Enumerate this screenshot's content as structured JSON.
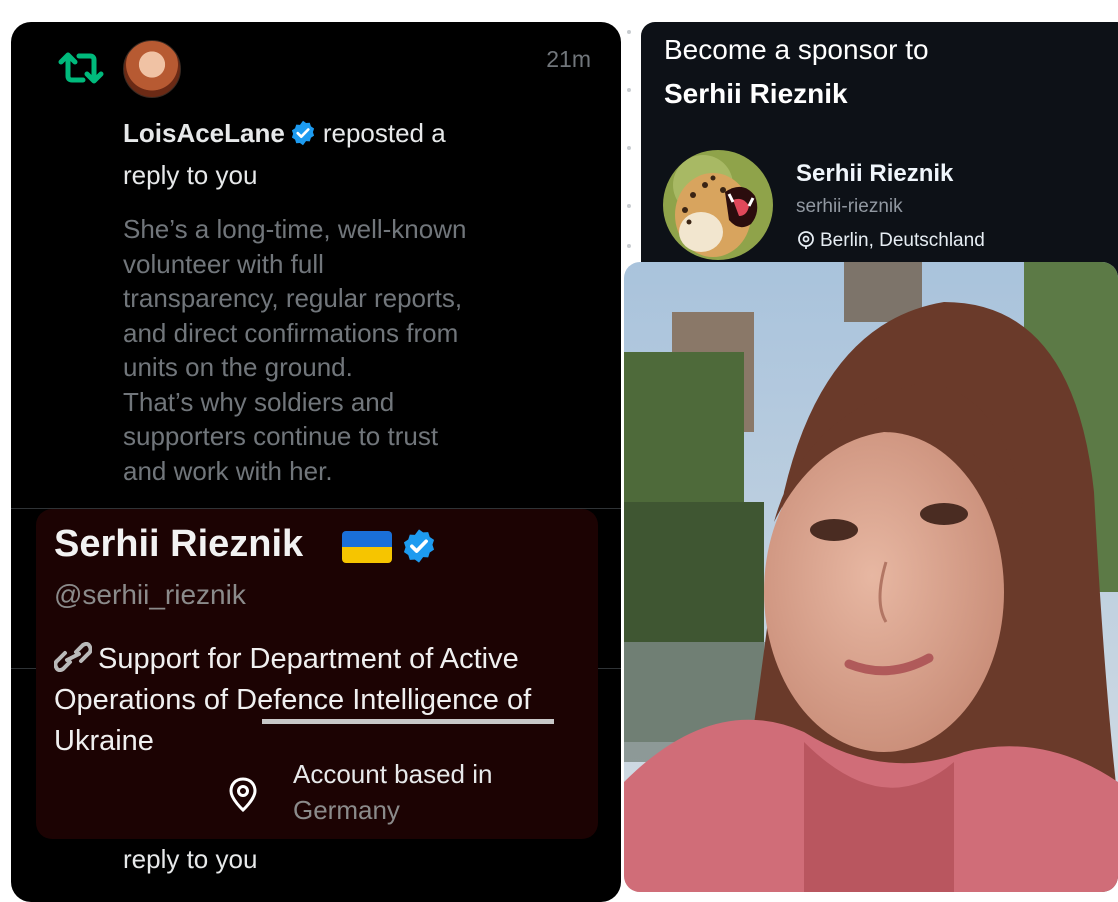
{
  "notification": {
    "time": "21m",
    "user": "LoisAceLane",
    "action": "reposted a",
    "line2": "reply to you",
    "reply_lines": [
      "She’s a long-time, well-known",
      "volunteer with full",
      "transparency, regular reports,",
      "and direct confirmations from",
      "units on the ground.",
      "That’s why soldiers and",
      "supporters continue to trust",
      "and work with her."
    ],
    "bottom_line": "reply to you",
    "colors": {
      "retweet": "#00ba7c",
      "verified": "#1d9bf0",
      "background": "#000000"
    }
  },
  "profile": {
    "name": "Serhii Rieznik",
    "handle": "@serhii_rieznik",
    "bio_line1": "Support for Department of Active",
    "bio_line2": "Operations of Defence Intelligence of",
    "bio_line3": "Ukraine",
    "based_label": "Account based in",
    "based_value": "Germany",
    "flag_colors": [
      "#1a6fd8",
      "#f6c500"
    ]
  },
  "sponsor": {
    "title1": "Become a sponsor to",
    "title2": "Serhii Rieznik",
    "name": "Serhii Rieznik",
    "login": "serhii-rieznik",
    "location": "Berlin, Deutschland"
  },
  "icons": [
    "retweet-icon",
    "verified-icon",
    "link-icon",
    "location-pin-icon",
    "ukraine-flag-icon"
  ]
}
